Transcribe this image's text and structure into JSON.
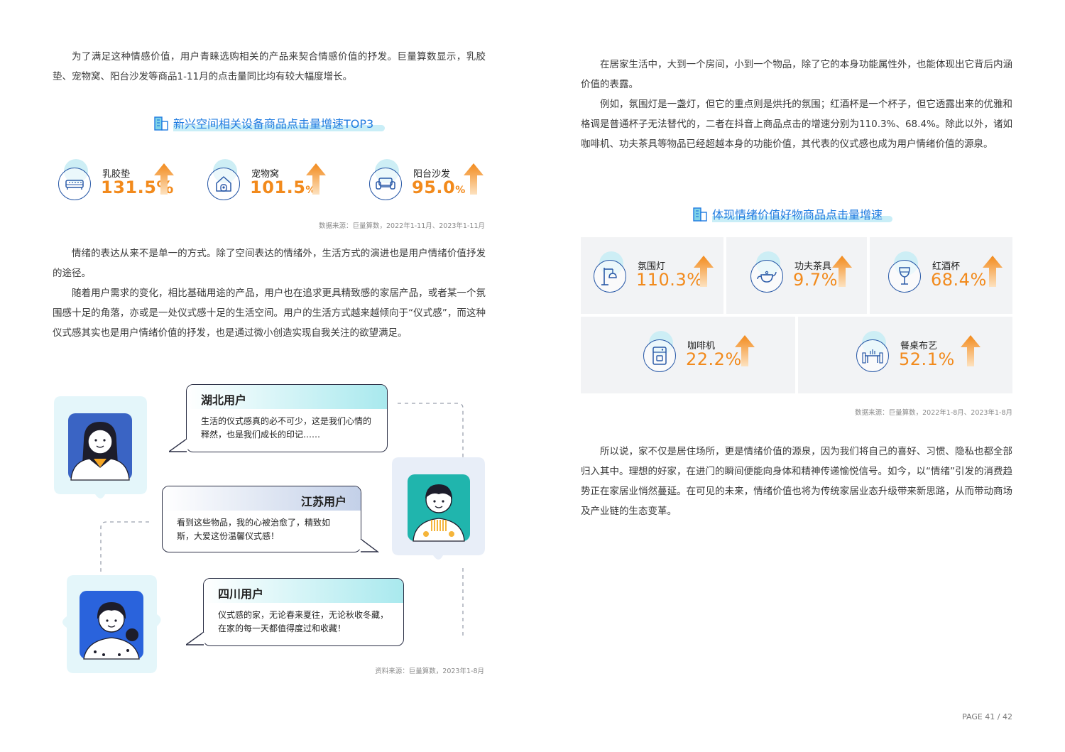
{
  "left": {
    "intro": "为了满足这种情感价值，用户青睐选购相关的产品来契合情感价值的抒发。巨量算数显示，乳胶垫、宠物窝、阳台沙发等商品1-11月的点击量同比均有较大幅度增长。",
    "section1_title": "新兴空间相关设备商品点击量增速TOP3",
    "stats": [
      {
        "name": "乳胶垫",
        "value": "131.5",
        "unit": "%",
        "icon": "mattress-icon"
      },
      {
        "name": "宠物窝",
        "value": "101.5",
        "unit": "%",
        "icon": "pet-house-icon"
      },
      {
        "name": "阳台沙发",
        "value": "95.0",
        "unit": "%",
        "icon": "sofa-icon"
      }
    ],
    "source1": "数据来源：巨量算数，2022年1-11月、2023年1-11月",
    "para2_p1": "情绪的表达从来不是单一的方式。除了空间表达的情绪外，生活方式的演进也是用户情绪价值抒发的途径。",
    "para2_p2": "随着用户需求的变化，相比基础用途的产品，用户也在追求更具精致感的家居产品，或者某一个氛围感十足的角落，亦或是一处仪式感十足的生活空间。用户的生活方式越来越倾向于“仪式感”，而这种仪式感其实也是用户情绪价值的抒发，也是通过微小创造实现自我关注的欲望满足。",
    "quotes": [
      {
        "title": "湖北用户",
        "text": "生活的仪式感真的必不可少，这是我们心情的释然，也是我们成长的印记……"
      },
      {
        "title": "江苏用户",
        "text": "看到这些物品，我的心被治愈了，精致如斯，大爱这份温馨仪式感！"
      },
      {
        "title": "四川用户",
        "text": "仪式感的家，无论春来夏往，无论秋收冬藏，在家的每一天都值得度过和收藏！"
      }
    ],
    "source2": "资料来源：巨量算数，2023年1-8月"
  },
  "right": {
    "para1_p1": "在居家生活中，大到一个房间，小到一个物品，除了它的本身功能属性外，也能体现出它背后内涵价值的表露。",
    "para1_p2": "例如，氛围灯是一盏灯，但它的重点则是烘托的氛围；红酒杯是一个杯子，但它透露出来的优雅和格调是普通杯子无法替代的，二者在抖音上商品点击的增速分别为110.3%、68.4%。除此以外，诸如咖啡机、功夫茶具等物品已经超越本身的功能价值，其代表的仪式感也成为用户情绪价值的源泉。",
    "section2_title": "体现情绪价值好物商品点击量增速",
    "stats": [
      {
        "name": "氛围灯",
        "value": "110.3%",
        "icon": "lamp-icon"
      },
      {
        "name": "功夫茶具",
        "value": "9.7%",
        "icon": "teapot-icon"
      },
      {
        "name": "红酒杯",
        "value": "68.4%",
        "icon": "wine-glass-icon"
      },
      {
        "name": "咖啡机",
        "value": "22.2%",
        "icon": "coffee-machine-icon"
      },
      {
        "name": "餐桌布艺",
        "value": "52.1%",
        "icon": "dining-table-icon"
      }
    ],
    "source": "数据来源：巨量算数，2022年1-8月、2023年1-8月",
    "para2": "所以说，家不仅是居住场所，更是情绪价值的源泉，因为我们将自己的喜好、习惯、隐私也都全部归入其中。理想的好家，在进门的瞬间便能向身体和精神传递愉悦信号。如今，以“情绪”引发的消费趋势正在家居业悄然蔓延。在可见的未来，情绪价值也将为传统家居业态升级带来新思路，从而带动商场及产业链的生态变革。"
  },
  "page_label": "PAGE 41 / 42",
  "colors": {
    "accent_orange": "#f28a1c",
    "title_blue": "#1f7be0",
    "icon_navy": "#2a5aa8",
    "highlight": "#c9eef7"
  }
}
